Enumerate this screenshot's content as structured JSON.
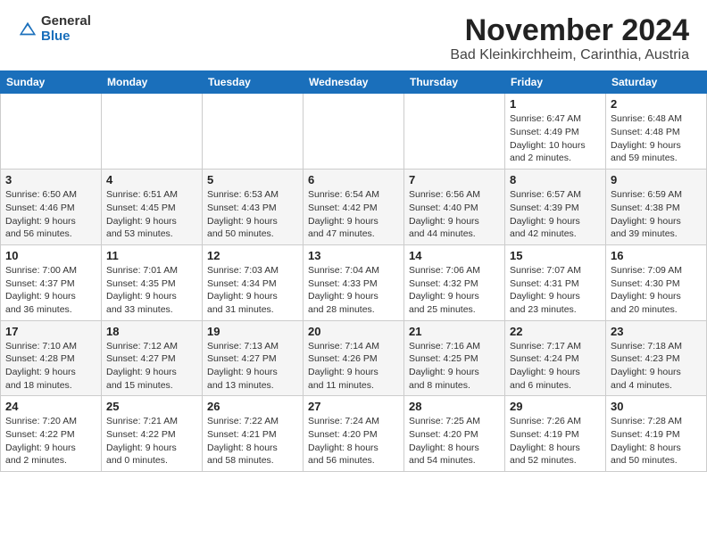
{
  "header": {
    "logo_general": "General",
    "logo_blue": "Blue",
    "title": "November 2024",
    "subtitle": "Bad Kleinkirchheim, Carinthia, Austria"
  },
  "weekdays": [
    "Sunday",
    "Monday",
    "Tuesday",
    "Wednesday",
    "Thursday",
    "Friday",
    "Saturday"
  ],
  "weeks": [
    [
      {
        "day": "",
        "info": ""
      },
      {
        "day": "",
        "info": ""
      },
      {
        "day": "",
        "info": ""
      },
      {
        "day": "",
        "info": ""
      },
      {
        "day": "",
        "info": ""
      },
      {
        "day": "1",
        "info": "Sunrise: 6:47 AM\nSunset: 4:49 PM\nDaylight: 10 hours\nand 2 minutes."
      },
      {
        "day": "2",
        "info": "Sunrise: 6:48 AM\nSunset: 4:48 PM\nDaylight: 9 hours\nand 59 minutes."
      }
    ],
    [
      {
        "day": "3",
        "info": "Sunrise: 6:50 AM\nSunset: 4:46 PM\nDaylight: 9 hours\nand 56 minutes."
      },
      {
        "day": "4",
        "info": "Sunrise: 6:51 AM\nSunset: 4:45 PM\nDaylight: 9 hours\nand 53 minutes."
      },
      {
        "day": "5",
        "info": "Sunrise: 6:53 AM\nSunset: 4:43 PM\nDaylight: 9 hours\nand 50 minutes."
      },
      {
        "day": "6",
        "info": "Sunrise: 6:54 AM\nSunset: 4:42 PM\nDaylight: 9 hours\nand 47 minutes."
      },
      {
        "day": "7",
        "info": "Sunrise: 6:56 AM\nSunset: 4:40 PM\nDaylight: 9 hours\nand 44 minutes."
      },
      {
        "day": "8",
        "info": "Sunrise: 6:57 AM\nSunset: 4:39 PM\nDaylight: 9 hours\nand 42 minutes."
      },
      {
        "day": "9",
        "info": "Sunrise: 6:59 AM\nSunset: 4:38 PM\nDaylight: 9 hours\nand 39 minutes."
      }
    ],
    [
      {
        "day": "10",
        "info": "Sunrise: 7:00 AM\nSunset: 4:37 PM\nDaylight: 9 hours\nand 36 minutes."
      },
      {
        "day": "11",
        "info": "Sunrise: 7:01 AM\nSunset: 4:35 PM\nDaylight: 9 hours\nand 33 minutes."
      },
      {
        "day": "12",
        "info": "Sunrise: 7:03 AM\nSunset: 4:34 PM\nDaylight: 9 hours\nand 31 minutes."
      },
      {
        "day": "13",
        "info": "Sunrise: 7:04 AM\nSunset: 4:33 PM\nDaylight: 9 hours\nand 28 minutes."
      },
      {
        "day": "14",
        "info": "Sunrise: 7:06 AM\nSunset: 4:32 PM\nDaylight: 9 hours\nand 25 minutes."
      },
      {
        "day": "15",
        "info": "Sunrise: 7:07 AM\nSunset: 4:31 PM\nDaylight: 9 hours\nand 23 minutes."
      },
      {
        "day": "16",
        "info": "Sunrise: 7:09 AM\nSunset: 4:30 PM\nDaylight: 9 hours\nand 20 minutes."
      }
    ],
    [
      {
        "day": "17",
        "info": "Sunrise: 7:10 AM\nSunset: 4:28 PM\nDaylight: 9 hours\nand 18 minutes."
      },
      {
        "day": "18",
        "info": "Sunrise: 7:12 AM\nSunset: 4:27 PM\nDaylight: 9 hours\nand 15 minutes."
      },
      {
        "day": "19",
        "info": "Sunrise: 7:13 AM\nSunset: 4:27 PM\nDaylight: 9 hours\nand 13 minutes."
      },
      {
        "day": "20",
        "info": "Sunrise: 7:14 AM\nSunset: 4:26 PM\nDaylight: 9 hours\nand 11 minutes."
      },
      {
        "day": "21",
        "info": "Sunrise: 7:16 AM\nSunset: 4:25 PM\nDaylight: 9 hours\nand 8 minutes."
      },
      {
        "day": "22",
        "info": "Sunrise: 7:17 AM\nSunset: 4:24 PM\nDaylight: 9 hours\nand 6 minutes."
      },
      {
        "day": "23",
        "info": "Sunrise: 7:18 AM\nSunset: 4:23 PM\nDaylight: 9 hours\nand 4 minutes."
      }
    ],
    [
      {
        "day": "24",
        "info": "Sunrise: 7:20 AM\nSunset: 4:22 PM\nDaylight: 9 hours\nand 2 minutes."
      },
      {
        "day": "25",
        "info": "Sunrise: 7:21 AM\nSunset: 4:22 PM\nDaylight: 9 hours\nand 0 minutes."
      },
      {
        "day": "26",
        "info": "Sunrise: 7:22 AM\nSunset: 4:21 PM\nDaylight: 8 hours\nand 58 minutes."
      },
      {
        "day": "27",
        "info": "Sunrise: 7:24 AM\nSunset: 4:20 PM\nDaylight: 8 hours\nand 56 minutes."
      },
      {
        "day": "28",
        "info": "Sunrise: 7:25 AM\nSunset: 4:20 PM\nDaylight: 8 hours\nand 54 minutes."
      },
      {
        "day": "29",
        "info": "Sunrise: 7:26 AM\nSunset: 4:19 PM\nDaylight: 8 hours\nand 52 minutes."
      },
      {
        "day": "30",
        "info": "Sunrise: 7:28 AM\nSunset: 4:19 PM\nDaylight: 8 hours\nand 50 minutes."
      }
    ]
  ]
}
